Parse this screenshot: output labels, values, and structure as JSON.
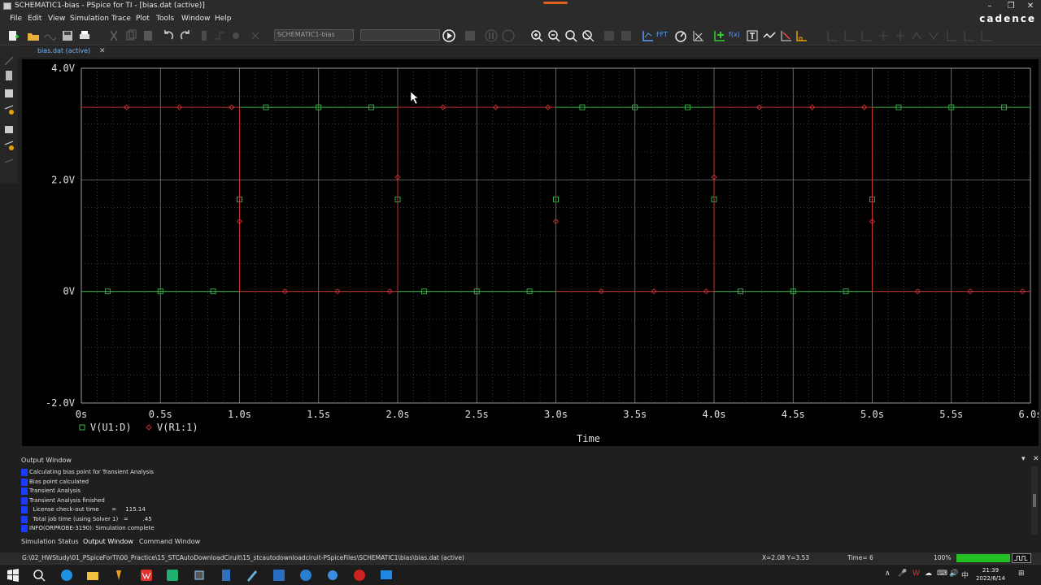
{
  "window": {
    "title": "SCHEMATIC1-bias - PSpice for TI - [bias.dat (active)]",
    "brand": "cadence",
    "minimize": "–",
    "restore": "❐",
    "close": "✕"
  },
  "menu": [
    "File",
    "Edit",
    "View",
    "Simulation",
    "Trace",
    "Plot",
    "Tools",
    "Window",
    "Help"
  ],
  "toolbar": {
    "profile": "SCHEMATIC1-bias",
    "fft_label": "FFT",
    "fx_label": "f(x)"
  },
  "document_tab": {
    "label": "bias.dat (active)",
    "close": "✕"
  },
  "chart_data": {
    "type": "line",
    "xlabel": "Time",
    "x_ticks": [
      "0s",
      "0.5s",
      "1.0s",
      "1.5s",
      "2.0s",
      "2.5s",
      "3.0s",
      "3.5s",
      "4.0s",
      "4.5s",
      "5.0s",
      "5.5s",
      "6.0s"
    ],
    "y_ticks": [
      "4.0V",
      "2.0V",
      "0V",
      "-2.0V"
    ],
    "xlim": [
      0,
      6
    ],
    "ylim": [
      -2,
      4
    ],
    "grid": true,
    "legend_position": "bottom-left",
    "series": [
      {
        "name": "V(U1:D)",
        "color": "#3ab54a",
        "marker": "square",
        "x": [
          0,
          1,
          1,
          2,
          2,
          3,
          3,
          4,
          4,
          5,
          5,
          6
        ],
        "y": [
          0,
          0,
          3.3,
          3.3,
          0,
          0,
          3.3,
          3.3,
          0,
          0,
          3.3,
          3.3
        ]
      },
      {
        "name": "V(R1:1)",
        "color": "#c23030",
        "marker": "diamond",
        "x": [
          0,
          1,
          1,
          2,
          2,
          3,
          3,
          4,
          4,
          5,
          5,
          6
        ],
        "y": [
          3.3,
          3.3,
          0,
          0,
          3.3,
          3.3,
          0,
          0,
          3.3,
          3.3,
          0,
          0
        ]
      }
    ]
  },
  "output_window": {
    "title": "Output Window",
    "close": "✕",
    "lines": [
      "Calculating bias point for Transient Analysis",
      "Bias point calculated",
      "Transient Analysis",
      "Transient Analysis finished",
      "  License check-out time       =     115.14",
      "  Total job time (using Solver 1)   =        .45",
      "INFO(ORPROBE-3190): Simulation complete"
    ],
    "tabs": [
      "Simulation Status",
      "Output Window",
      "Command Window"
    ]
  },
  "status": {
    "path": "G:\\02_HWStudy\\01_PSpiceForTI\\00_Practice\\15_STCAutoDownloadCiruit\\15_stcautodownloadciruit-PSpiceFiles\\SCHEMATIC1\\bias\\bias.dat (active)",
    "cursor": "X=2.08  Y=3.53",
    "time": "Time= 6",
    "zoom": "100%",
    "progress": 1.0
  },
  "taskbar": {
    "time": "21:39",
    "date": "2022/6/14",
    "tray": [
      "∧",
      "🎤",
      "W",
      "☁",
      "⌨",
      "🔊",
      "中",
      "⊞"
    ]
  }
}
